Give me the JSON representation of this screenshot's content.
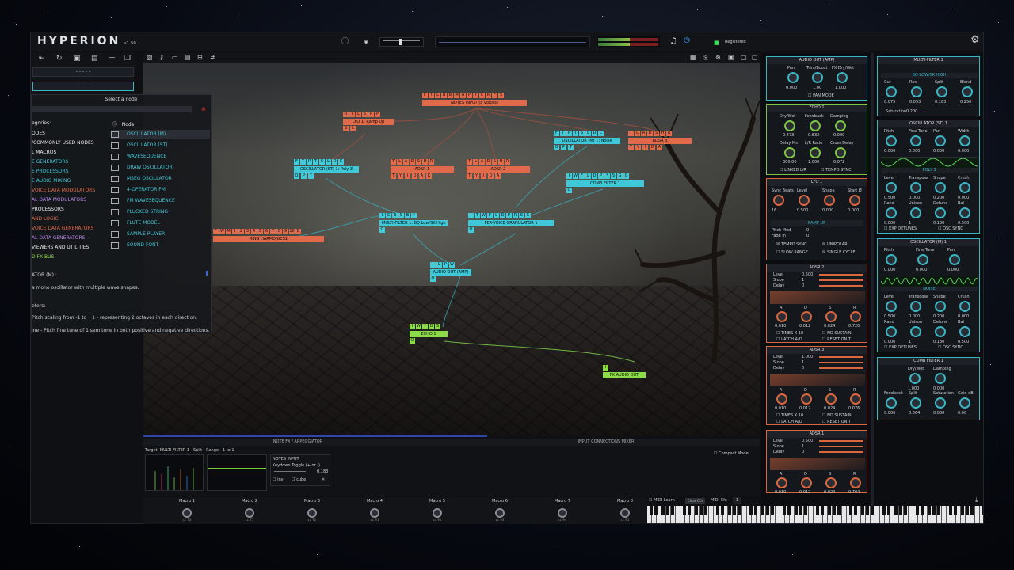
{
  "app": {
    "name": "HYPERION",
    "version": "v1.50",
    "status": "Registered"
  },
  "canvas_nodes": [
    {
      "id": "notes",
      "label": "NOTES INPUT (8 voices)",
      "buttons": [
        "F",
        "T",
        "L",
        "N",
        "B",
        "M",
        "A",
        "P",
        "Y",
        "C",
        "R",
        "*",
        "S"
      ]
    },
    {
      "id": "lfo1",
      "label": "LFO 1: Ramp Up",
      "buttons": [
        "O",
        "T",
        "L",
        "S",
        "P",
        "P"
      ],
      "ports": [
        "S",
        "L"
      ]
    },
    {
      "id": "osc_st",
      "label": "OSCILLATOR (ST) 1: Poly 3",
      "buttons": [
        "F",
        "T",
        "P",
        "T",
        "S",
        "L",
        "D",
        "C"
      ],
      "ports": [
        "O",
        "P",
        "T"
      ]
    },
    {
      "id": "adsr1",
      "label": "ADSR 1",
      "buttons": [
        "T",
        "L",
        "A",
        "D",
        "S",
        "H",
        "R"
      ],
      "ports": [
        "T",
        "Y",
        "I",
        "D",
        "A",
        "K"
      ]
    },
    {
      "id": "adsr2",
      "label": "ADSR 2",
      "buttons": [
        "T",
        "L",
        "A",
        "D",
        "S",
        "H",
        "R"
      ],
      "ports": [
        "T",
        "Y",
        "I",
        "D",
        "A"
      ]
    },
    {
      "id": "osc_m",
      "label": "OSCILLATOR (M) 1: Noise",
      "buttons": [
        "F",
        "T",
        "P",
        "T",
        "S",
        "L",
        "D",
        "C"
      ],
      "ports": [
        "O",
        "P",
        "T"
      ]
    },
    {
      "id": "adsr3",
      "label": "ADSR 3",
      "buttons": [
        "T",
        "L",
        "A",
        "D",
        "S",
        "H",
        "R"
      ],
      "ports": [
        "T",
        "Y",
        "I",
        "D",
        "A"
      ]
    },
    {
      "id": "comb",
      "label": "COMB FILTER 1",
      "buttons": [
        "I",
        "W",
        "F",
        "L",
        "D",
        "P",
        "*",
        "S",
        "G",
        "G"
      ],
      "ports": [
        "O"
      ]
    },
    {
      "id": "ring",
      "label": "RING HARMONICS1",
      "buttons": [
        "F",
        "W",
        "M",
        "I",
        "2",
        "3",
        "4",
        "5",
        "6",
        "7",
        "8",
        "9",
        "10",
        "D"
      ]
    },
    {
      "id": "mfilter",
      "label": "MULTI-FILTER 1: BQ Low/SK High",
      "buttons": [
        "I",
        "C",
        "R",
        "S",
        "B",
        "*"
      ],
      "ports": [
        "O"
      ]
    },
    {
      "id": "gran",
      "label": "PER-VOICE GRANULATOR 1",
      "buttons": [
        "I",
        "T",
        "W",
        "F",
        "L",
        "D",
        "P",
        "R",
        "S",
        "S"
      ],
      "ports": [
        "O"
      ]
    },
    {
      "id": "aout",
      "label": "AUDIO OUT (AMP)",
      "buttons": [
        "I",
        "L",
        "P",
        "W"
      ],
      "ports": [
        "O"
      ]
    },
    {
      "id": "echo",
      "label": "ECHO 1",
      "buttons": [
        "I",
        "W",
        "*",
        "D",
        "S"
      ],
      "ports": [
        "O"
      ]
    },
    {
      "id": "fxout",
      "label": "FX AUDIO OUT",
      "buttons": [
        "I"
      ]
    }
  ],
  "node_selector": {
    "title": "Select a node",
    "categories_header": "egories:",
    "node_header": "Node:",
    "categories": [
      {
        "label": "ODES",
        "color": "#e8e8e8"
      },
      {
        "label": "/COMMONLY USED NODES",
        "color": "#e8e8e8"
      },
      {
        "label": "L MACROS",
        "color": "#e8e8e8"
      },
      {
        "label": "E GENERATORS",
        "color": "#3fc6d6"
      },
      {
        "label": "E PROCESSORS",
        "color": "#3fc6d6"
      },
      {
        "label": "E AUDIO MIXING",
        "color": "#3fc6d6"
      },
      {
        "label": "VOICE DATA MODULATORS",
        "color": "#e06a4a"
      },
      {
        "label": "AL DATA MODULATORS",
        "color": "#b983ee"
      },
      {
        "label": "PROCESSORS",
        "color": "#e8e8e8"
      },
      {
        "label": "AND LOGIC",
        "color": "#e06a4a"
      },
      {
        "label": "VOICE DATA GENERATORS",
        "color": "#e06a4a"
      },
      {
        "label": "AL DATA GENERATORS",
        "color": "#b983ee"
      },
      {
        "label": "VIEWERS AND UTILITIES",
        "color": "#e8e8e8"
      },
      {
        "label": "D FX BUS",
        "color": "#8cdc48"
      }
    ],
    "nodes": [
      "OSCILLATOR (M)",
      "OSCILLATOR (ST)",
      "WAVESEQUENCE",
      "DRAW OSCILLATOR",
      "MSEG OSCILLATOR",
      "4-OPERATOR FM",
      "FM WAVESEQUENCE",
      "PLUCKED STRING",
      "FLUTE MODEL",
      "SAMPLE PLAYER",
      "SOUND FONT"
    ],
    "desc_title": "ATOR (M) :",
    "desc": "a mono oscillator with multiple wave shapes.",
    "params_header": "eters:",
    "param1": "Pitch scaling from -1 to +1 - representing 2 octaves in each direction.",
    "param2": "ine - Pitch fine tune of 1 semitone in both positive and negative directions."
  },
  "right_modules": {
    "audio_out": {
      "title": "AUDIO OUT (AMP)",
      "labels": [
        "Pan",
        "Trim/Boost",
        "FX Dry/Wet"
      ],
      "values": [
        "0.000",
        "1.00",
        "1.000"
      ],
      "check": "PAN MODE"
    },
    "echo": {
      "title": "ECHO 1",
      "labels": [
        "Dry/Wet",
        "Feedback",
        "Damping",
        "Delay Ms",
        "L/R Ratio",
        "Cross Delay"
      ],
      "values": [
        "0.473",
        "0.632",
        "0.000",
        "300.00",
        "1.000",
        "0.072"
      ],
      "checks": [
        "LINKED L/R",
        "TEMPO SYNC"
      ]
    },
    "lfo": {
      "title": "LFO 1",
      "labels": [
        "Sync Beats",
        "Level",
        "Shape",
        "Start Ø"
      ],
      "values": [
        "16",
        "0.500",
        "0.000",
        "0.000"
      ],
      "mode": "RAMP UP",
      "rows": [
        "Pitch Mod",
        "Fade In"
      ],
      "rowvals": [
        "0",
        "0"
      ],
      "checks": [
        "TEMPO SYNC",
        "UNIPOLAR",
        "SLOW RANGE",
        "SINGLE CYCLE"
      ]
    },
    "adsr2": {
      "title": "ADSR 2",
      "rows": [
        "Level",
        "Slope",
        "Delay"
      ],
      "rowvals": [
        "0.500",
        "1",
        "0"
      ],
      "knobs": [
        "A",
        "D",
        "S",
        "R"
      ],
      "values": [
        "0.010",
        "0.012",
        "0.024",
        "0.720"
      ],
      "checks": [
        "TIMES X 10",
        "NO SUSTAIN",
        "LATCH A/D",
        "RESET ON T"
      ]
    },
    "adsr3": {
      "title": "ADSR 3",
      "rows": [
        "Level",
        "Slope",
        "Delay"
      ],
      "rowvals": [
        "1.000",
        "1",
        "0"
      ],
      "knobs": [
        "A",
        "D",
        "S",
        "R"
      ],
      "values": [
        "0.010",
        "0.012",
        "0.024",
        "0.076"
      ],
      "checks": [
        "TIMES X 10",
        "NO SUSTAIN",
        "LATCH A/D",
        "RESET ON T"
      ]
    },
    "adsr1": {
      "title": "ADSR 1",
      "rows": [
        "Level",
        "Slope",
        "Delay"
      ],
      "rowvals": [
        "0.500",
        "1",
        "0"
      ],
      "knobs": [
        "A",
        "D",
        "S",
        "R"
      ],
      "values": [
        "0.010",
        "0.012",
        "0.024",
        "0.704"
      ]
    },
    "mfilter": {
      "title": "MULTI-FILTER 1",
      "mode": "BQ LOW/SK HIGH",
      "labels": [
        "Cut",
        "Res",
        "Split",
        "Blend"
      ],
      "values": [
        "0.075",
        "0.053",
        "0.183",
        "0.250"
      ],
      "sat_label": "Saturation",
      "sat_value": "0.200"
    },
    "osc_st": {
      "title": "OSCILLATOR (ST) 1",
      "labels": [
        "Pitch",
        "Fine Tune",
        "Pan",
        "Width"
      ],
      "values": [
        "0.000",
        "0.000",
        "0.000",
        "0.000"
      ],
      "wave": "POLY 3",
      "labels2": [
        "Level",
        "Transpose",
        "Shape",
        "Crush"
      ],
      "values2": [
        "0.500",
        "0.000",
        "0.200",
        "0.000"
      ],
      "labels3": [
        "Rand",
        "Unison",
        "Detune",
        "Bal"
      ],
      "values3": [
        "0.000",
        "1",
        "0.130",
        "0.500"
      ],
      "checks": [
        "EXP DETUNES",
        "OSC SYNC"
      ]
    },
    "osc_m": {
      "title": "OSCILLATOR (M) 1",
      "labels": [
        "Pitch",
        "Fine Tune",
        "Pan"
      ],
      "values": [
        "0.000",
        "0.000",
        "0.000"
      ],
      "wave": "NOISE",
      "labels2": [
        "Level",
        "Transpose",
        "Shape",
        "Crush"
      ],
      "values2": [
        "0.500",
        "0.000",
        "0.200",
        "0.000"
      ],
      "labels3": [
        "Rand",
        "Unison",
        "Detune",
        "Bal"
      ],
      "values3": [
        "0.000",
        "1",
        "0.130",
        "0.500"
      ],
      "checks": [
        "EXP DETUNES",
        "OSC SYNC"
      ]
    },
    "comb": {
      "title": "COMB FILTER 1",
      "labels": [
        "Dry/Wet",
        "Damping"
      ],
      "values": [
        "1.000",
        "0.000"
      ],
      "labels2": [
        "Feedback",
        "Split",
        "Saturation",
        "Gain dB"
      ],
      "values2": [
        "0.000",
        "0.064",
        "0.000",
        "0.00"
      ]
    }
  },
  "bottom": {
    "tab1": "NOTE FX / ARPEGGIATOR",
    "tab2": "INPUT CONNECTIONS MIXER",
    "target": "Target: MULTI-FILTER 1 - Split - Range: -1 to 1",
    "notes_input": "NOTES INPUT",
    "keydown": "Keydown Toggle (+ or -)",
    "keydown_val": "0.183",
    "inv": "inv",
    "cube": "cube",
    "compact": "Compact Mode"
  },
  "macros": [
    {
      "label": "Macro 1",
      "cc": "cc 73"
    },
    {
      "label": "Macro 2",
      "cc": "cc 75"
    },
    {
      "label": "Macro 3",
      "cc": "cc 72"
    },
    {
      "label": "Macro 4",
      "cc": "cc 91"
    },
    {
      "label": "Macro 5",
      "cc": "cc 92"
    },
    {
      "label": "Macro 6",
      "cc": "cc 93"
    },
    {
      "label": "Macro 7",
      "cc": "cc 94"
    },
    {
      "label": "Macro 8",
      "cc": "cc 95"
    }
  ],
  "midi": {
    "learn": "MIDI Learn",
    "clear": "Clear CCs",
    "ch_label": "MIDI Ch:",
    "ch": "1"
  }
}
